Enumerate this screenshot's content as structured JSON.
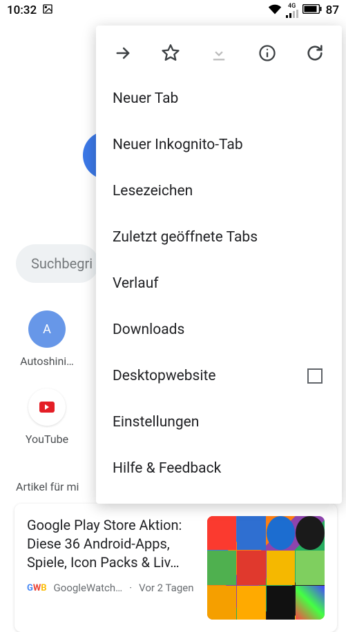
{
  "status_bar": {
    "time": "10:32",
    "battery_text": "87",
    "network_label": "4G"
  },
  "search": {
    "placeholder": "Suchbegri"
  },
  "shortcuts": [
    {
      "letter": "A",
      "label": "Autoshini…"
    },
    {
      "letter": "",
      "label": "YouTube"
    }
  ],
  "articles_header": "Artikel für mi",
  "article": {
    "title": "Google Play Store Aktion: Diese 36 Android-Apps, Spiele, Icon Packs & Liv…",
    "source_badge": "GWB",
    "source": "GoogleWatch…",
    "separator": "·",
    "age": "Vor 2 Tagen"
  },
  "menu": {
    "icons": {
      "forward": "forward-icon",
      "star": "star-icon",
      "download": "download-icon",
      "info": "info-icon",
      "reload": "reload-icon"
    },
    "items": [
      "Neuer Tab",
      "Neuer Inkognito-Tab",
      "Lesezeichen",
      "Zuletzt geöffnete Tabs",
      "Verlauf",
      "Downloads",
      "Desktopwebsite",
      "Einstellungen",
      "Hilfe & Feedback"
    ],
    "desktop_checkbox_index": 6
  }
}
